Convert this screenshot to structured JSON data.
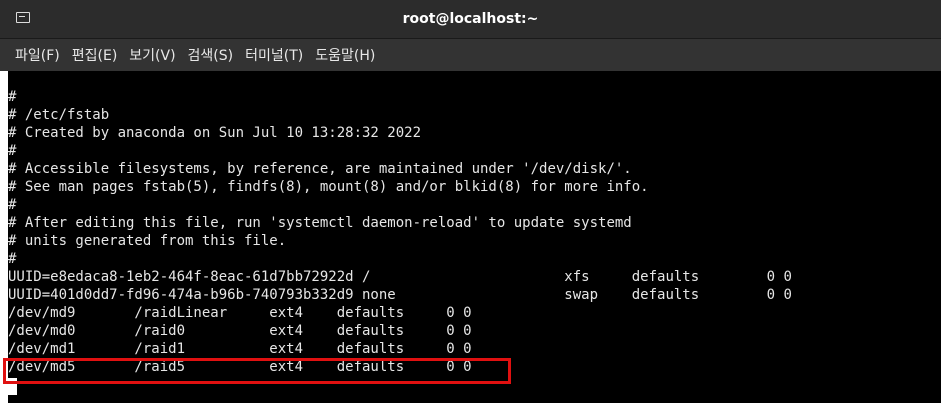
{
  "window": {
    "title": "root@localhost:~",
    "icon": "terminal-icon"
  },
  "menu": [
    {
      "label": "파일(F)"
    },
    {
      "label": "편집(E)"
    },
    {
      "label": "보기(V)"
    },
    {
      "label": "검색(S)"
    },
    {
      "label": "터미널(T)"
    },
    {
      "label": "도움말(H)"
    }
  ],
  "terminal": {
    "lines": [
      "",
      "#",
      "# /etc/fstab",
      "# Created by anaconda on Sun Jul 10 13:28:32 2022",
      "#",
      "# Accessible filesystems, by reference, are maintained under '/dev/disk/'.",
      "# See man pages fstab(5), findfs(8), mount(8) and/or blkid(8) for more info.",
      "#",
      "# After editing this file, run 'systemctl daemon-reload' to update systemd",
      "# units generated from this file.",
      "#",
      "UUID=e8edaca8-1eb2-464f-8eac-61d7bb72922d /                       xfs     defaults        0 0",
      "UUID=401d0dd7-fd96-474a-b96b-740793b332d9 none                    swap    defaults        0 0",
      "/dev/md9       /raidLinear     ext4    defaults     0 0",
      "/dev/md0       /raid0          ext4    defaults     0 0",
      "/dev/md1       /raid1          ext4    defaults     0 0",
      "/dev/md5       /raid5          ext4    defaults     0 0"
    ]
  },
  "colors": {
    "highlight": "#e01010",
    "titlebar": "#2c2c2c",
    "menubar": "#333333"
  }
}
